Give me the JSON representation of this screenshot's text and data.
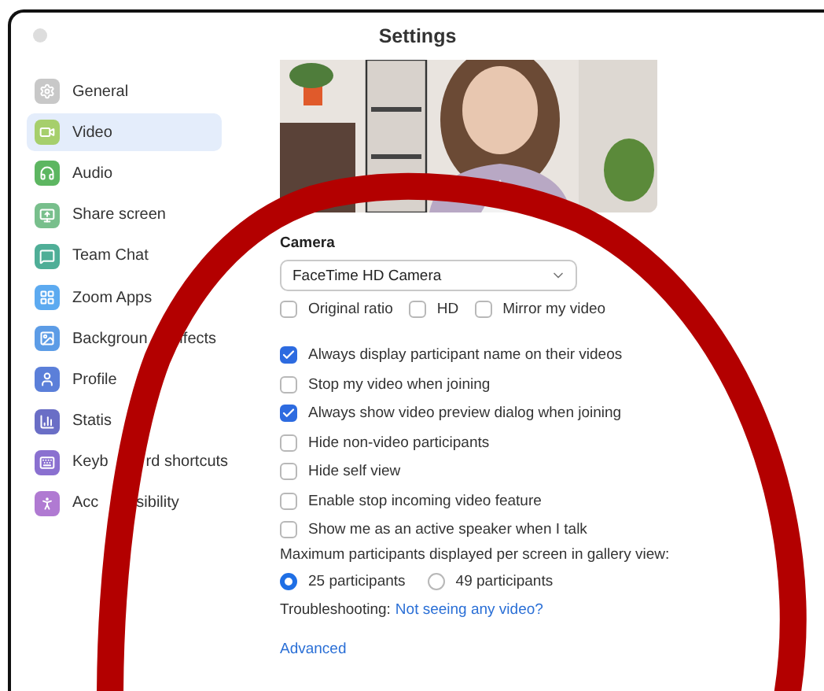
{
  "window": {
    "title": "Settings"
  },
  "sidebar": {
    "items": [
      {
        "label": "General",
        "selected": false,
        "color": "#c8c8c8"
      },
      {
        "label": "Video",
        "selected": true,
        "color": "#a6cf6c"
      },
      {
        "label": "Audio",
        "selected": false,
        "color": "#5db661"
      },
      {
        "label": "Share screen",
        "selected": false,
        "color": "#78bf8c"
      },
      {
        "label": "Team Chat",
        "selected": false,
        "color": "#4fae97"
      },
      {
        "label": "Zoom Apps",
        "selected": false,
        "color": "#5caaf0"
      },
      {
        "label": "Backgroun",
        "label_end": "ffects",
        "selected": false,
        "color": "#5c9ce6"
      },
      {
        "label": "Profile",
        "selected": false,
        "color": "#5b7fd9"
      },
      {
        "label": "Statis",
        "selected": false,
        "color": "#6a6ec6"
      },
      {
        "label": "Keyb",
        "label_end": "rd shortcuts",
        "selected": false,
        "color": "#8a70d0"
      },
      {
        "label": "Acc",
        "label_end": "sibility",
        "selected": false,
        "color": "#b07ad2"
      }
    ]
  },
  "camera": {
    "label": "Camera",
    "device": "FaceTime HD Camera",
    "options": [
      {
        "label": "Original ratio",
        "checked": false
      },
      {
        "label": "HD",
        "checked": false
      },
      {
        "label": "Mirror my video",
        "checked": false
      }
    ]
  },
  "video_options": [
    {
      "label": "Always display participant name on their videos",
      "checked": true
    },
    {
      "label": "Stop my video when joining",
      "checked": false
    },
    {
      "label": "Always show video preview dialog when joining",
      "checked": true
    },
    {
      "label": "Hide non-video participants",
      "checked": false
    },
    {
      "label": "Hide self view",
      "checked": false
    },
    {
      "label": "Enable stop incoming video feature",
      "checked": false
    },
    {
      "label": "Show me as an active speaker when I talk",
      "checked": false
    }
  ],
  "gallery": {
    "label": "Maximum participants displayed per screen in gallery view:",
    "options": [
      {
        "label": "25 participants",
        "selected": true
      },
      {
        "label": "49 participants",
        "selected": false
      }
    ]
  },
  "troubleshooting": {
    "label": "Troubleshooting:",
    "link": "Not seeing any video?"
  },
  "advanced": "Advanced"
}
